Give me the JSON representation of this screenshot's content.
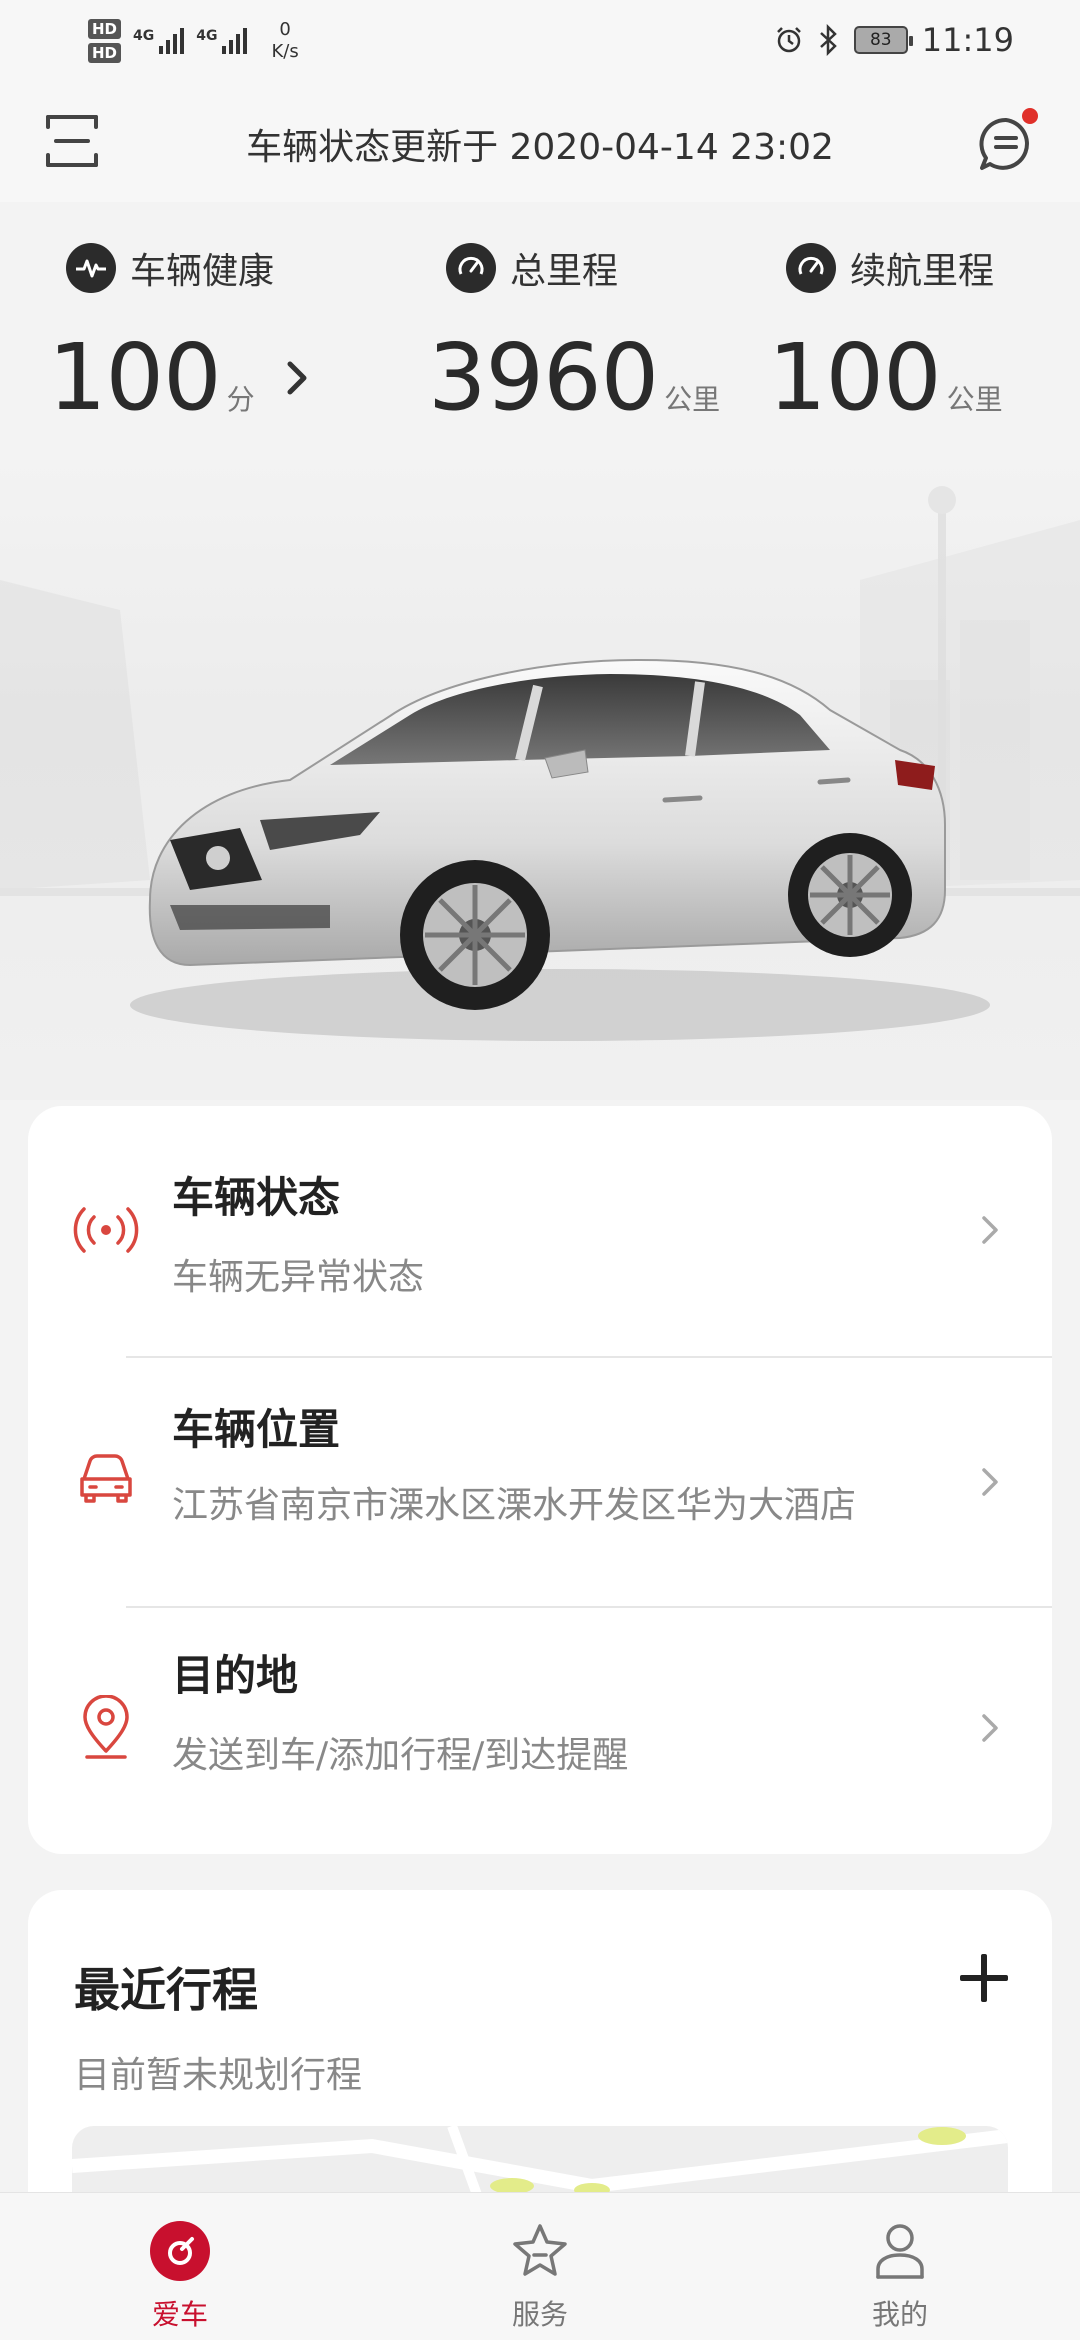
{
  "status_bar": {
    "hd1": "HD",
    "hd2": "HD",
    "net1": "4G",
    "net2": "4G",
    "speed_value": "0",
    "speed_unit": "K/s",
    "battery": "83",
    "time": "11:19"
  },
  "header": {
    "title": "车辆状态更新于  2020-04-14 23:02"
  },
  "stats": [
    {
      "label": "车辆健康",
      "value": "100",
      "unit": "分"
    },
    {
      "label": "总里程",
      "value": "3960",
      "unit": "公里"
    },
    {
      "label": "续航里程",
      "value": "100",
      "unit": "公里"
    }
  ],
  "main_card": {
    "rows": [
      {
        "title": "车辆状态",
        "subtitle": "车辆无异常状态",
        "icon": "signal-broadcast-icon"
      },
      {
        "title": "车辆位置",
        "subtitle": "江苏省南京市溧水区溧水开发区华为大酒店",
        "icon": "car-icon"
      },
      {
        "title": "目的地",
        "subtitle": "发送到车/添加行程/到达提醒",
        "icon": "location-pin-icon"
      }
    ]
  },
  "trips": {
    "title": "最近行程",
    "subtitle": "目前暂未规划行程"
  },
  "bottom_nav": {
    "items": [
      {
        "label": "爱车",
        "icon": "steering-wheel-icon",
        "active": true
      },
      {
        "label": "服务",
        "icon": "star-icon",
        "active": false
      },
      {
        "label": "我的",
        "icon": "person-icon",
        "active": false
      }
    ]
  },
  "colors": {
    "accent": "#c8102e",
    "icon_red": "#d9473f",
    "background": "#f3f3f3"
  }
}
